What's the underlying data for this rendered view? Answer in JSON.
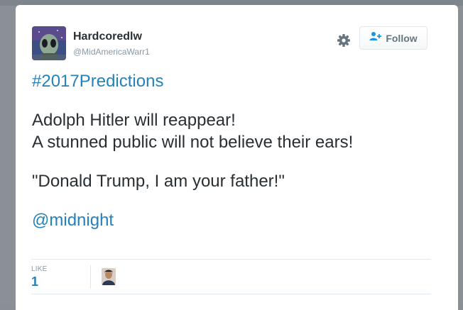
{
  "user": {
    "display_name": "Hardcoredlw",
    "handle": "@MidAmericaWarr1"
  },
  "actions": {
    "follow_label": "Follow",
    "settings_icon": "gear-icon",
    "follow_icon": "add-user-icon"
  },
  "tweet": {
    "hashtag": "#2017Predictions",
    "line1": "Adolph Hitler will reappear!",
    "line2": "A stunned public will not believe their ears!",
    "quote": "\"Donald Trump, I am your father!\"",
    "mention": "@midnight"
  },
  "stats": {
    "like_label": "LIKE",
    "like_count": "1"
  },
  "colors": {
    "link": "#2582b8",
    "text": "#292f33",
    "muted": "#8899a6"
  }
}
